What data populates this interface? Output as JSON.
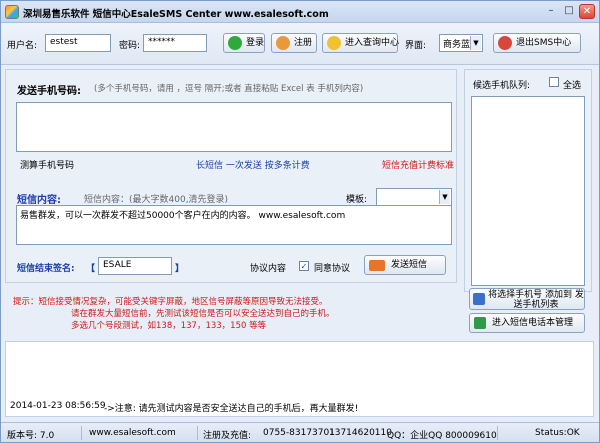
{
  "window": {
    "title": "深圳易售乐软件 短信中心EsaleSMS Center  www.esalesoft.com",
    "min": "–",
    "max": "□",
    "close": "✕"
  },
  "toolbar": {
    "username_label": "用户名:",
    "username_value": "estest",
    "password_label": "密码:",
    "password_value": "******",
    "login": "登录",
    "register": "注册",
    "query_center": "进入查询中心",
    "ui_label": "界面:",
    "ui_value": "商务蓝",
    "exit": "退出SMS中心"
  },
  "send": {
    "phone_label": "发送手机号码:",
    "phone_hint": "(多个手机号码，请用 ，逗号  隔开;或者  直接粘贴 Excel 表 手机列内容)",
    "count_label": "测算手机号码",
    "long_sms": "长短信 一次发送 按多条计费",
    "rate_link": "短信充值计费标准",
    "content_label": "短信内容:",
    "content_hint": "短信内容：(最大字数400,清先登录)",
    "template_label": "模板:",
    "template_value": "",
    "content_text": "易售群发，可以一次群发不超过50000个客户在内的内容。 www.esalesoft.com",
    "sign_label": "短信结束签名:",
    "sign_open": "【",
    "sign_value": "ESALE",
    "sign_close": "】",
    "agreement": "协议内容",
    "agree": "同意协议",
    "send_btn": "发送短信"
  },
  "notice": {
    "line1": "提示：短信接受情况复杂，可能受关键字屏蔽，地区信号屏蔽等原因导致无法接受。",
    "line2": "请在群发大量短信前，先测试该短信是否可以安全送达到自己的手机。",
    "line3": "多选几个号段测试，如138，137，133，150 等等"
  },
  "right": {
    "queue_label": "候选手机队列:",
    "select_all": "全选",
    "add_to_list": "将选择手机号 添加到 发送手机列表",
    "phonebook": "进入短信电话本管理"
  },
  "log": {
    "time": "2014-01-23  08:56:59",
    "message": "->注意: 请先测试内容是否安全送达自己的手机后，再大量群发!"
  },
  "status": {
    "version": "版本号: 7.0",
    "site": "www.esalesoft.com",
    "register": "注册及充值:",
    "phone1": "0755-83173701",
    "phone2": "13714620110",
    "qq": "QQ：企业QQ 800009610",
    "state": "Status:OK"
  },
  "colors": {
    "accent_blue": "#1a3fa8",
    "warn_red": "#d01818"
  }
}
